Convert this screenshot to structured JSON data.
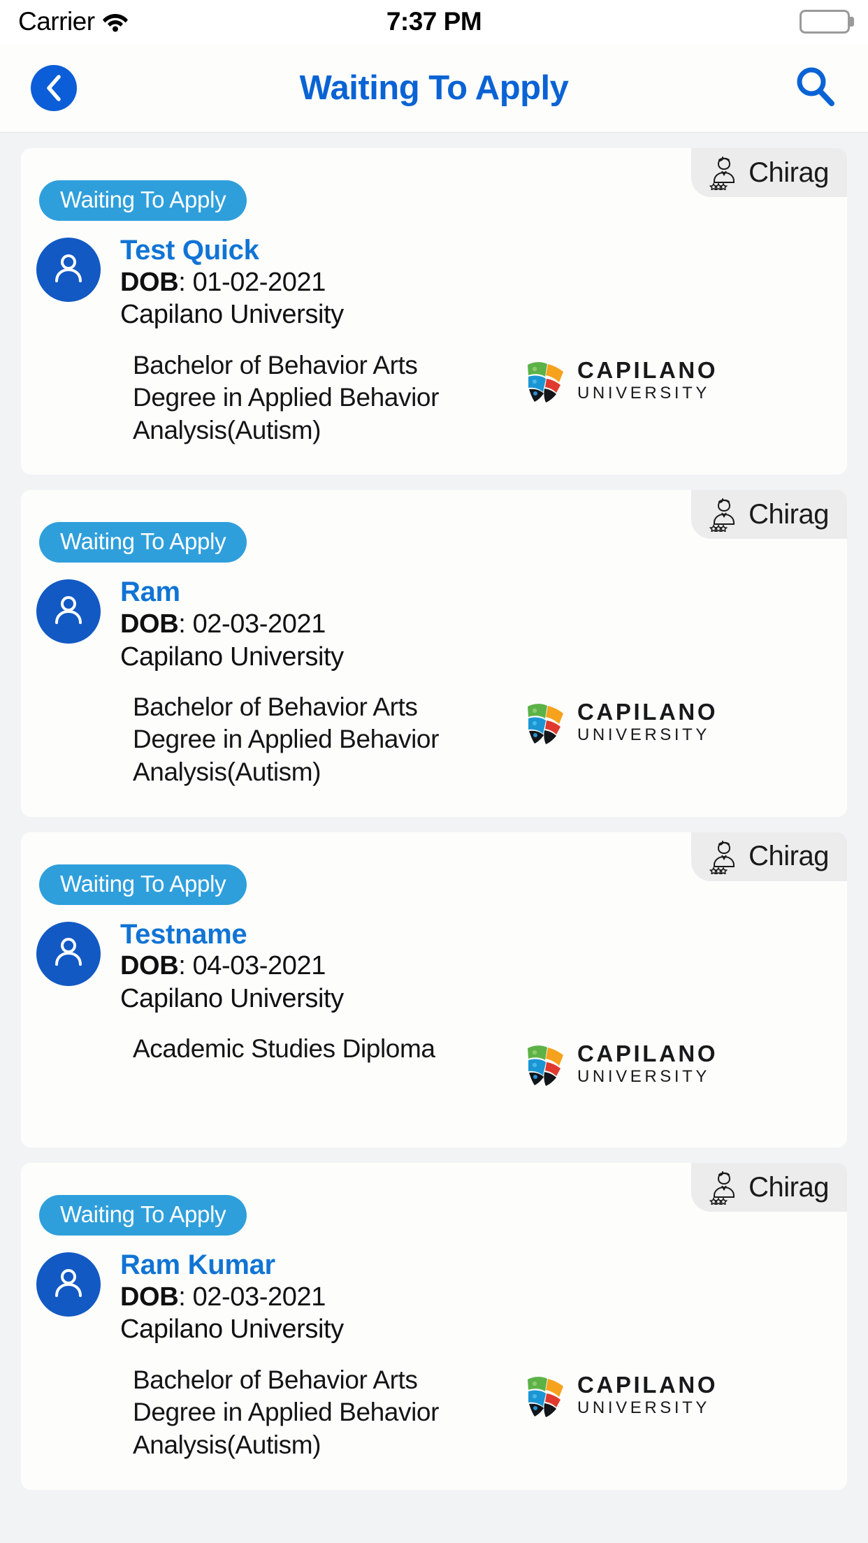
{
  "status_bar": {
    "carrier": "Carrier",
    "time": "7:37 PM",
    "wifi_icon": "wifi-icon",
    "battery_icon": "battery-full-icon"
  },
  "nav_bar": {
    "title": "Waiting To Apply",
    "back_icon": "chevron-left-icon",
    "search_icon": "search-icon",
    "title_color": "#0a63d4",
    "back_button_color": "#0b5ed7"
  },
  "theme": {
    "page_background": "#f2f3f4",
    "card_background": "#fdfefc",
    "pill_color": "#2f9fdc",
    "avatar_color": "#1259c4",
    "name_color": "#1174d4",
    "badge_background": "#ececec"
  },
  "cards": [
    {
      "assignee": "Chirag",
      "assignee_icon": "user-rating-icon",
      "status": "Waiting To Apply",
      "avatar_icon": "person-icon",
      "name": "Test  Quick",
      "dob_label": "DOB",
      "dob_value": "01-02-2021",
      "university": "Capilano University",
      "program": "Bachelor of Behavior Arts\nDegree in Applied Behavior\nAnalysis(Autism)",
      "logo_name": "CAPILANO",
      "logo_sub": "UNIVERSITY"
    },
    {
      "assignee": "Chirag",
      "assignee_icon": "user-rating-icon",
      "status": "Waiting To Apply",
      "avatar_icon": "person-icon",
      "name": "Ram",
      "dob_label": "DOB",
      "dob_value": "02-03-2021",
      "university": "Capilano University",
      "program": "Bachelor of Behavior Arts\nDegree in Applied Behavior\nAnalysis(Autism)",
      "logo_name": "CAPILANO",
      "logo_sub": "UNIVERSITY"
    },
    {
      "assignee": "Chirag",
      "assignee_icon": "user-rating-icon",
      "status": "Waiting To Apply",
      "avatar_icon": "person-icon",
      "name": "Testname",
      "dob_label": "DOB",
      "dob_value": "04-03-2021",
      "university": "Capilano University",
      "program": "Academic Studies Diploma",
      "logo_name": "CAPILANO",
      "logo_sub": "UNIVERSITY"
    },
    {
      "assignee": "Chirag",
      "assignee_icon": "user-rating-icon",
      "status": "Waiting To Apply",
      "avatar_icon": "person-icon",
      "name": "Ram Kumar",
      "dob_label": "DOB",
      "dob_value": "02-03-2021",
      "university": "Capilano University",
      "program": "Bachelor of Behavior Arts\nDegree in Applied Behavior\nAnalysis(Autism)",
      "logo_name": "CAPILANO",
      "logo_sub": "UNIVERSITY"
    }
  ]
}
